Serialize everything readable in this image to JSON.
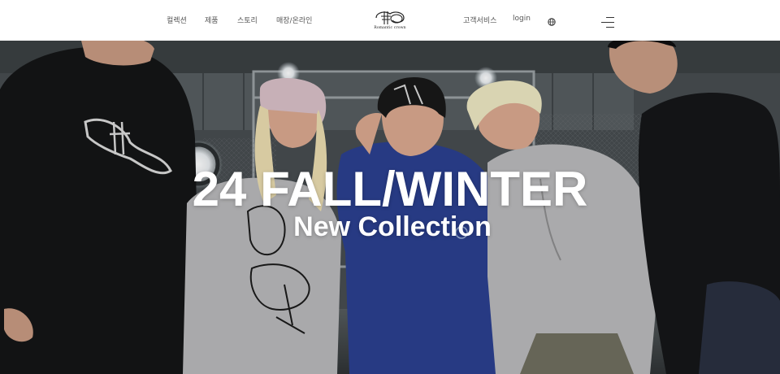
{
  "header": {
    "nav_left": [
      "컬렉션",
      "제품",
      "스토리",
      "매장/온라인"
    ],
    "logo_text": "Romantic crown",
    "nav_right": [
      "고객서비스",
      "login"
    ],
    "icons": {
      "language": "globe-icon",
      "menu": "hamburger-menu-icon"
    }
  },
  "hero": {
    "title": "24 FALL/WINTER",
    "subtitle": "New Collection"
  },
  "colors": {
    "header_bg": "#ffffff",
    "nav_text": "#555555",
    "hero_text": "#ffffff",
    "blue_hoodie": "#2b3f8f",
    "grey_hoodie": "#b8b8ba",
    "black_hoodie": "#141516"
  }
}
